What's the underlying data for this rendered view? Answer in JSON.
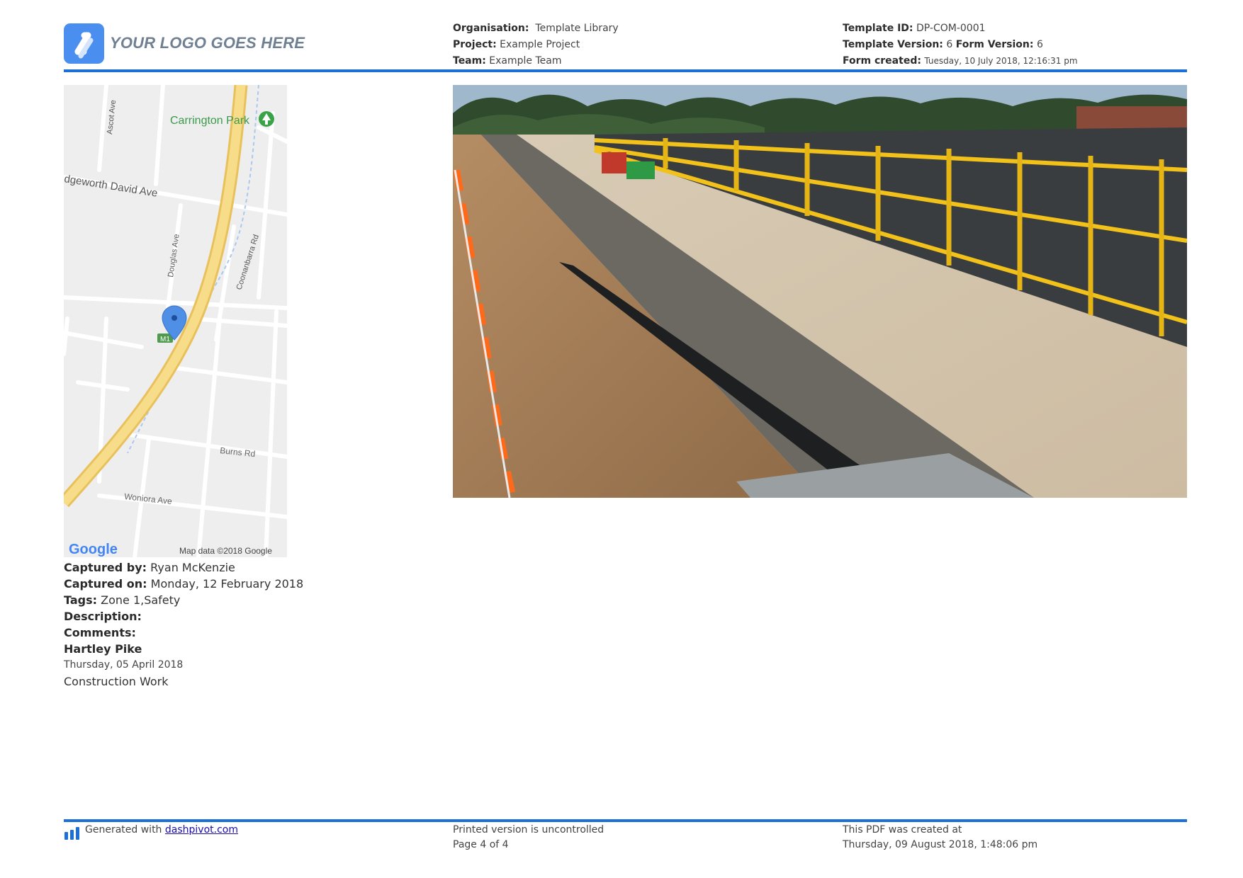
{
  "header": {
    "logo_text": "YOUR LOGO GOES HERE",
    "organisation_label": "Organisation:",
    "organisation_value": "Template Library",
    "project_label": "Project:",
    "project_value": "Example Project",
    "team_label": "Team:",
    "team_value": "Example Team",
    "template_id_label": "Template ID:",
    "template_id_value": "DP-COM-0001",
    "template_version_label": "Template Version:",
    "template_version_value": "6",
    "form_version_label": "Form Version:",
    "form_version_value": "6",
    "form_created_label": "Form created:",
    "form_created_value": "Tuesday, 10 July 2018, 12:16:31 pm"
  },
  "map": {
    "labels": {
      "ascot": "Ascot Ave",
      "carrington": "Carrington Park",
      "edgeworth": "dgeworth David Ave",
      "douglas": "Douglas Ave",
      "coonanbarra": "Coonanbarra Rd",
      "m1": "M1",
      "burns": "Burns Rd",
      "woniora": "Woniora Ave",
      "google": "Google",
      "attribution": "Map data ©2018 Google"
    }
  },
  "details": {
    "captured_by_label": "Captured by:",
    "captured_by_value": "Ryan McKenzie",
    "captured_on_label": "Captured on:",
    "captured_on_value": "Monday, 12 February 2018",
    "tags_label": "Tags:",
    "tags_value": "Zone 1,Safety",
    "description_label": "Description:",
    "comments_label": "Comments:",
    "commenter_name": "Hartley Pike",
    "comment_date": "Thursday, 05 April 2018",
    "comment_text": "Construction Work"
  },
  "footer": {
    "generated_prefix": "Generated with",
    "generated_link": "dashpivot.com",
    "uncontrolled": "Printed version is uncontrolled",
    "page": "Page 4 of 4",
    "created_at_label": "This PDF was created at",
    "created_at_value": "Thursday, 09 August 2018, 1:48:06 pm"
  },
  "colors": {
    "accent_blue": "#1a6fd8",
    "logo_blue": "#4a8ef0"
  }
}
